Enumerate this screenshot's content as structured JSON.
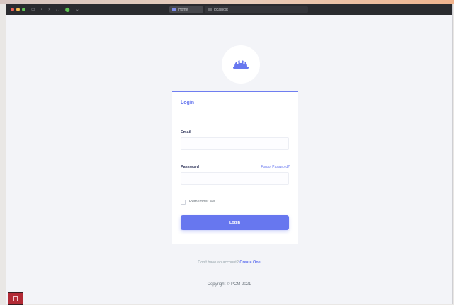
{
  "browser": {
    "tabs": [
      {
        "label": "Home",
        "active": true
      },
      {
        "label": "localhost",
        "active": false
      }
    ]
  },
  "brand": {
    "logo_icon": "hard-hat-icon",
    "accent_color": "#6777ef"
  },
  "login_card": {
    "title": "Login",
    "email_label": "Email",
    "email_value": "",
    "password_label": "Password",
    "password_value": "",
    "forgot_link": "Forgot Password?",
    "remember_label": "Remember Me",
    "remember_checked": false,
    "submit_label": "Login"
  },
  "footer": {
    "signup_prompt": "Don't have an account?",
    "signup_link": "Create One",
    "copyright": "Copyright © PCM 2021"
  }
}
